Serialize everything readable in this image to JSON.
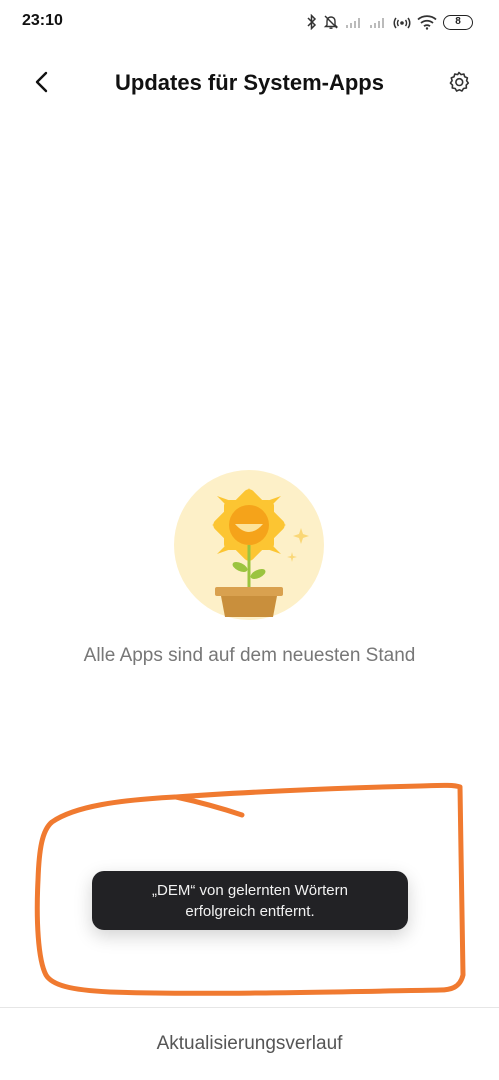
{
  "status_bar": {
    "time": "23:10",
    "battery_level": "8",
    "icons": [
      "bluetooth-icon",
      "bell-muted-icon",
      "signal-icon",
      "signal-icon",
      "hotspot-icon",
      "wifi-icon",
      "battery-icon"
    ]
  },
  "header": {
    "title": "Updates für System-Apps",
    "back_icon": "chevron-left-icon",
    "settings_icon": "gear-icon"
  },
  "main": {
    "illustration": "sunflower-pot-illustration",
    "message": "Alle Apps sind auf dem neuesten Stand"
  },
  "toast": {
    "line1": "„DEM“ von gelernten Wörtern",
    "line2": "erfolgreich entfernt."
  },
  "footer": {
    "link_label": "Aktualisierungsverlauf"
  },
  "colors": {
    "annotation_stroke": "#f07a30",
    "toast_background": "#222225",
    "illustration_circle": "#fdf0c8",
    "petals": "#fcc532",
    "flower_face": "#f5a31a",
    "pot": "#d9a14f",
    "leaves": "#9bc43f"
  }
}
